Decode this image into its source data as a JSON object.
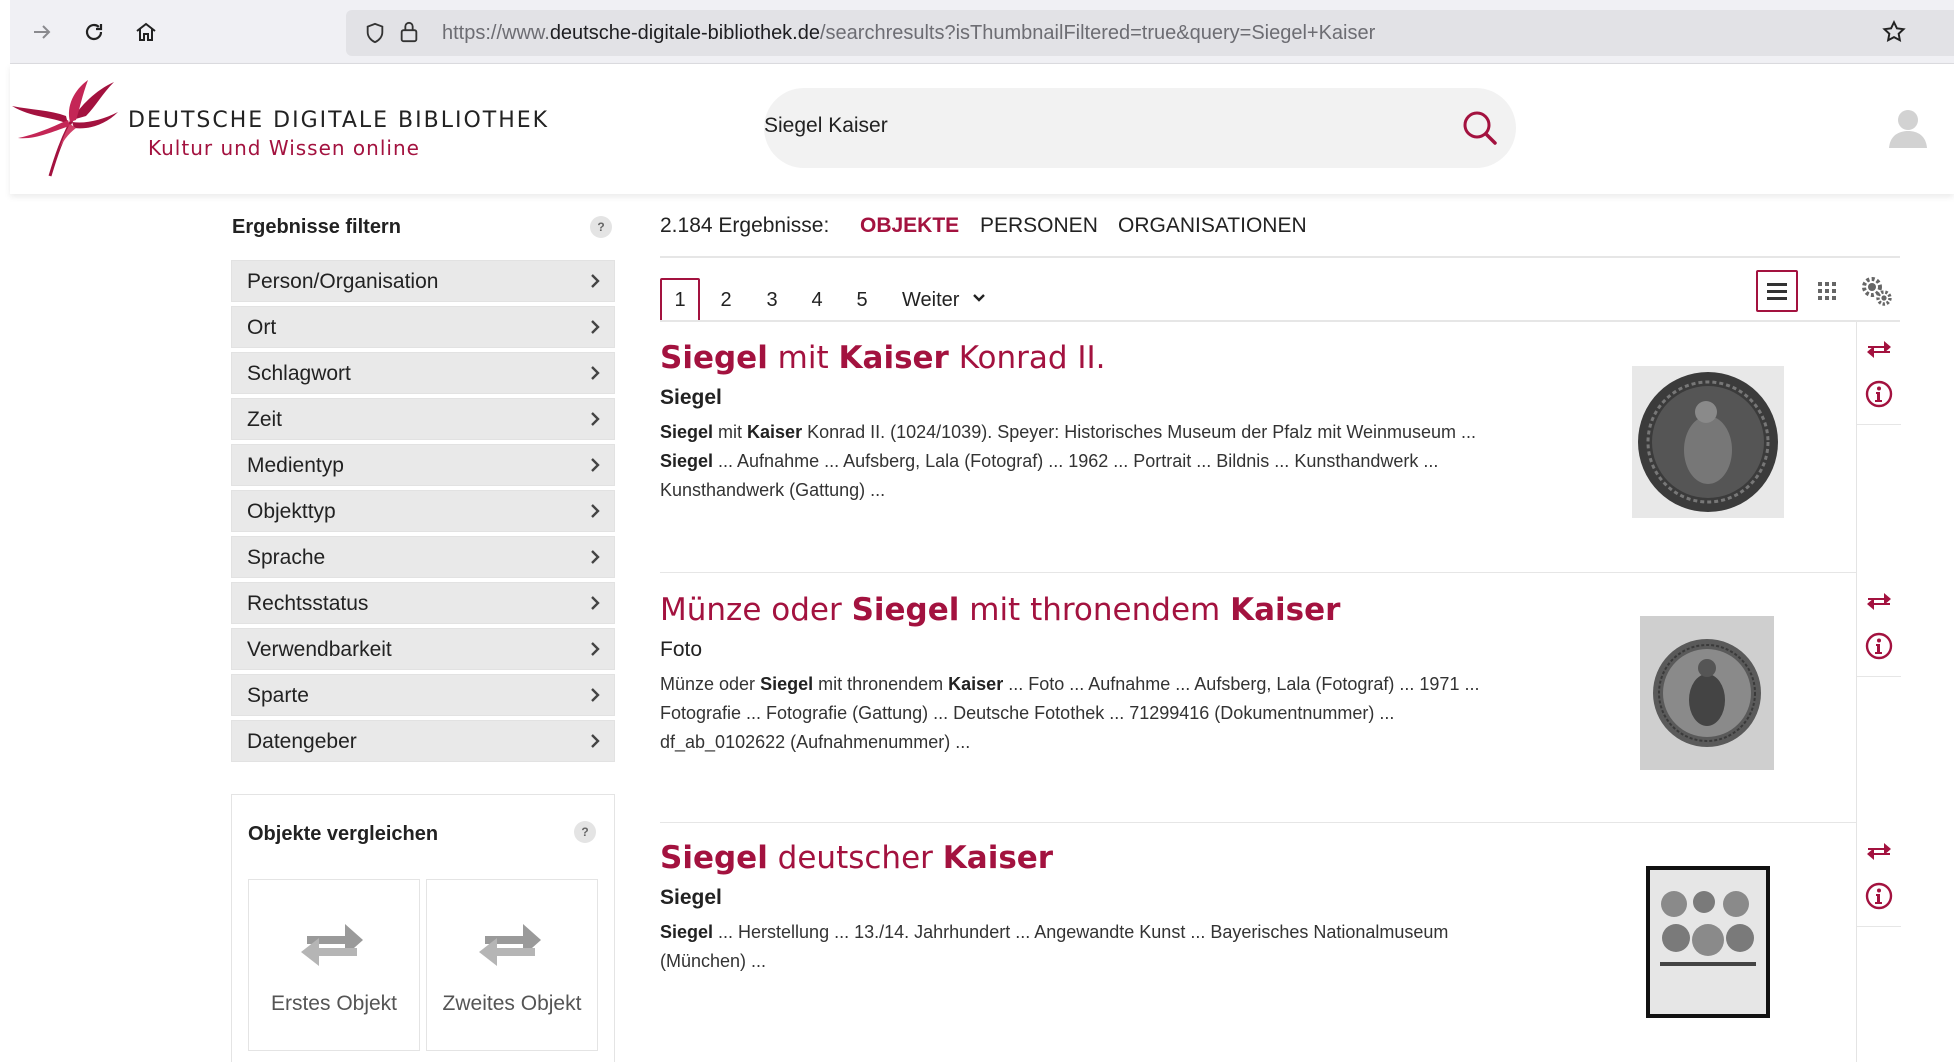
{
  "browser": {
    "url_prefix": "https://www.",
    "url_host": "deutsche-digitale-bibliothek.de",
    "url_path": "/searchresults?isThumbnailFiltered=true&query=Siegel+Kaiser"
  },
  "header": {
    "logo_line1": "DEUTSCHE DIGITALE BIBLIOTHEK",
    "logo_line2": "Kultur und Wissen online",
    "search_value": "Siegel Kaiser"
  },
  "sidebar": {
    "title": "Ergebnisse filtern",
    "help": "?",
    "facets": [
      {
        "label": "Person/Organisation"
      },
      {
        "label": "Ort"
      },
      {
        "label": "Schlagwort"
      },
      {
        "label": "Zeit"
      },
      {
        "label": "Medientyp"
      },
      {
        "label": "Objekttyp"
      },
      {
        "label": "Sprache"
      },
      {
        "label": "Rechtsstatus"
      },
      {
        "label": "Verwendbarkeit"
      },
      {
        "label": "Sparte"
      },
      {
        "label": "Datengeber"
      }
    ],
    "compare": {
      "title": "Objekte vergleichen",
      "help": "?",
      "slot1": "Erstes Objekt",
      "slot2": "Zweites Objekt"
    }
  },
  "results_header": {
    "count": "2.184 Ergebnisse:",
    "tabs": [
      {
        "label": "OBJEKTE"
      },
      {
        "label": "PERSONEN"
      },
      {
        "label": "ORGANISATIONEN"
      }
    ]
  },
  "pager": {
    "pages": [
      "1",
      "2",
      "3",
      "4",
      "5"
    ],
    "next": "Weiter"
  },
  "results": [
    {
      "title": [
        {
          "t": "Siegel",
          "b": true
        },
        {
          "t": " mit ",
          "b": false
        },
        {
          "t": "Kaiser",
          "b": true
        },
        {
          "t": " Konrad II.",
          "b": false
        }
      ],
      "type": "Siegel",
      "snippet": [
        {
          "t": "Siegel",
          "b": true
        },
        {
          "t": " mit ",
          "b": false
        },
        {
          "t": "Kaiser",
          "b": true
        },
        {
          "t": " Konrad II. (1024/1039). Speyer: Historisches Museum der Pfalz mit Weinmuseum ... ",
          "b": false
        },
        {
          "t": "Siegel",
          "b": true
        },
        {
          "t": " ... Aufnahme ... Aufsberg, Lala (Fotograf) ... 1962 ... Portrait ... Bildnis ... Kunsthandwerk ... Kunsthandwerk (Gattung) ...",
          "b": false
        }
      ]
    },
    {
      "title": [
        {
          "t": "Münze oder ",
          "b": false
        },
        {
          "t": "Siegel",
          "b": true
        },
        {
          "t": " mit thronendem ",
          "b": false
        },
        {
          "t": "Kaiser",
          "b": true
        }
      ],
      "type": "Foto",
      "snippet": [
        {
          "t": "Münze oder ",
          "b": false
        },
        {
          "t": "Siegel",
          "b": true
        },
        {
          "t": " mit thronendem ",
          "b": false
        },
        {
          "t": "Kaiser",
          "b": true
        },
        {
          "t": " ... Foto ... Aufnahme ... Aufsberg, Lala (Fotograf) ... 1971 ... Fotografie ... Fotografie (Gattung) ... Deutsche Fotothek ... 71299416 (Dokumentnummer) ... df_ab_0102622 (Aufnahmenummer) ...",
          "b": false
        }
      ]
    },
    {
      "title": [
        {
          "t": "Siegel",
          "b": true
        },
        {
          "t": " deutscher ",
          "b": false
        },
        {
          "t": "Kaiser",
          "b": true
        }
      ],
      "type": "Siegel",
      "snippet": [
        {
          "t": "Siegel",
          "b": true
        },
        {
          "t": " ... Herstellung ... 13./14. Jahrhundert ... Angewandte Kunst ... Bayerisches Nationalmuseum (München) ...",
          "b": false
        }
      ]
    }
  ],
  "colors": {
    "brand": "#a3123f",
    "facet_bg": "#e9e9e9",
    "search_bg": "#f2f2f2"
  },
  "icons": [
    "back-arrow-icon",
    "reload-icon",
    "home-icon",
    "shield-icon",
    "lock-icon",
    "star-icon",
    "search-icon",
    "user-icon",
    "chevron-right-icon",
    "chevron-down-icon",
    "list-view-icon",
    "grid-view-icon",
    "settings-gears-icon",
    "compare-arrows-icon",
    "info-icon"
  ]
}
